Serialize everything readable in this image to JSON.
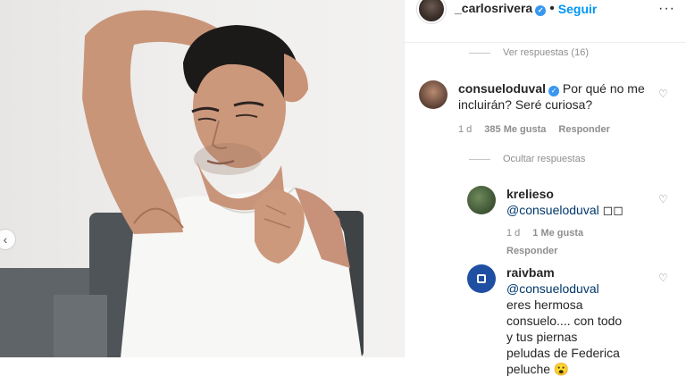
{
  "header": {
    "username": "_carlosrivera",
    "separator": "•",
    "follow_label": "Seguir",
    "more_label": "···",
    "verified_glyph": "✓"
  },
  "photo": {
    "nav_prev_label": "‹"
  },
  "threads": {
    "view_replies": "Ver respuestas (16)",
    "hide_replies": "Ocultar respuestas"
  },
  "comments": [
    {
      "username": "consueloduval",
      "verified": true,
      "text": "Por qué no me incluirán? Seré curiosa?",
      "time": "1 d",
      "likes": "385 Me gusta",
      "reply_label": "Responder"
    },
    {
      "username": "krelieso",
      "mention": "@consueloduval",
      "text": "◻◻",
      "time": "1 d",
      "likes": "1 Me gusta",
      "reply_label": "Responder"
    },
    {
      "username": "raivbam",
      "mention": "@consueloduval",
      "text": "eres hermosa consuelo.... con todo y tus piernas peludas de Federica peluche 😮"
    }
  ],
  "icons": {
    "heart": "♡"
  },
  "colors": {
    "accent": "#0095f6",
    "verified": "#3897f0",
    "mention": "#00376b",
    "muted": "#8e8e8e"
  }
}
